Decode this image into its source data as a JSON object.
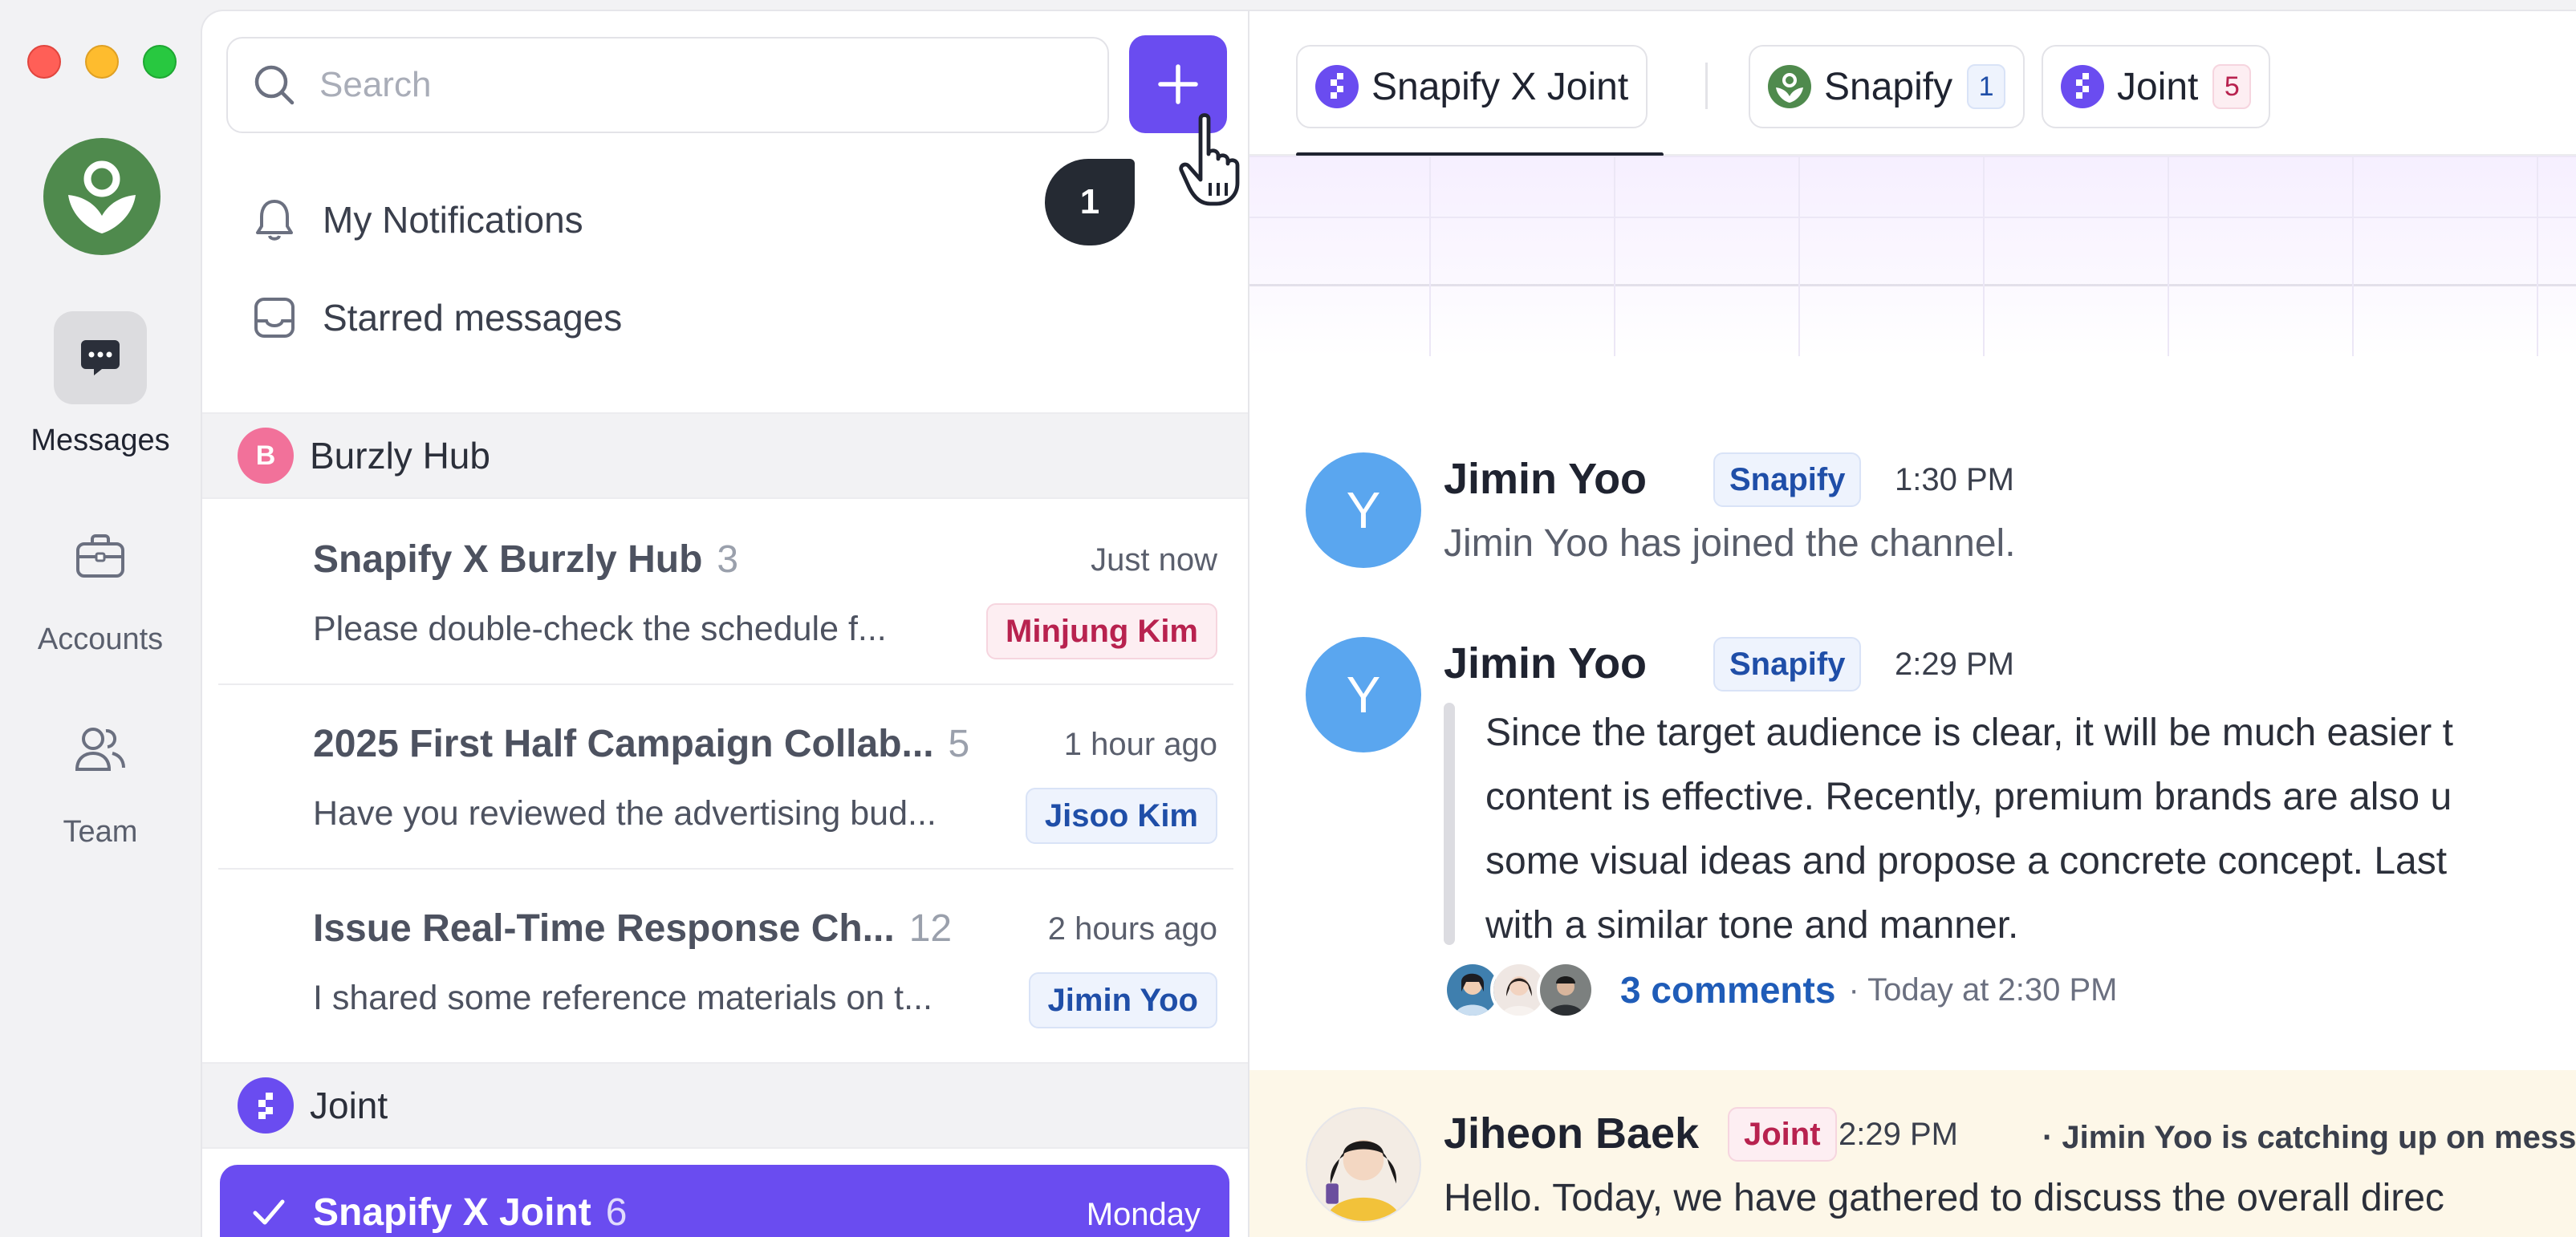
{
  "rail": {
    "items": [
      {
        "label": "Messages",
        "icon": "chat-bubble-icon",
        "active": true
      },
      {
        "label": "Accounts",
        "icon": "briefcase-icon",
        "active": false
      },
      {
        "label": "Team",
        "icon": "team-icon",
        "active": false
      }
    ]
  },
  "list": {
    "search_placeholder": "Search",
    "notification_count": "1",
    "menu": [
      {
        "label": "My Notifications",
        "icon": "bell-icon"
      },
      {
        "label": "Starred messages",
        "icon": "inbox-icon"
      }
    ],
    "groups": [
      {
        "name": "Burzly Hub",
        "initial": "B",
        "color": "#f2719a",
        "conversations": [
          {
            "title": "Snapify X Burzly Hub",
            "count": "3",
            "time": "Just now",
            "preview": "Please double-check the schedule f...",
            "tag": "Minjung Kim",
            "tag_style": "pink"
          },
          {
            "title": "2025 First Half Campaign Collab...",
            "count": "5",
            "time": "1 hour ago",
            "preview": "Have you reviewed the advertising bud...",
            "tag": "Jisoo Kim",
            "tag_style": "blue"
          },
          {
            "title": "Issue Real-Time Response Ch...",
            "count": "12",
            "time": "2 hours ago",
            "preview": "I shared some reference materials on t...",
            "tag": "Jimin Yoo",
            "tag_style": "blue"
          }
        ]
      },
      {
        "name": "Joint",
        "color": "#6a4cf0",
        "conversations": [
          {
            "title": "Snapify X Joint",
            "count": "6",
            "time": "Monday",
            "selected": true
          }
        ]
      }
    ]
  },
  "chat": {
    "tabs": [
      {
        "label": "Snapify X Joint",
        "active": true
      },
      {
        "label": "Snapify",
        "count": "1"
      },
      {
        "label": "Joint",
        "count": "5"
      }
    ],
    "messages": [
      {
        "initial": "Y",
        "name": "Jimin Yoo",
        "org": "Snapify",
        "time": "1:30 PM",
        "body": "Jimin Yoo has joined the channel."
      },
      {
        "initial": "Y",
        "name": "Jimin Yoo",
        "org": "Snapify",
        "time": "2:29 PM",
        "quote_lines": [
          "Since the target audience is clear, it will be much easier t",
          "content is effective. Recently, premium brands are also u",
          "some visual ideas and propose a concrete concept. Last",
          "with a similar tone and manner."
        ],
        "comments_label": "3 comments",
        "comments_time": "· Today at 2:30 PM"
      },
      {
        "name": "Jiheon Baek",
        "org": "Joint",
        "time": "2:29 PM",
        "note": "· Jimin Yoo is catching up on messag",
        "body": "Hello. Today, we have gathered to discuss the overall direc"
      }
    ]
  },
  "colors": {
    "accent": "#6a4cf0",
    "brand_green": "#4f8a4d",
    "link": "#1f5cb8"
  }
}
